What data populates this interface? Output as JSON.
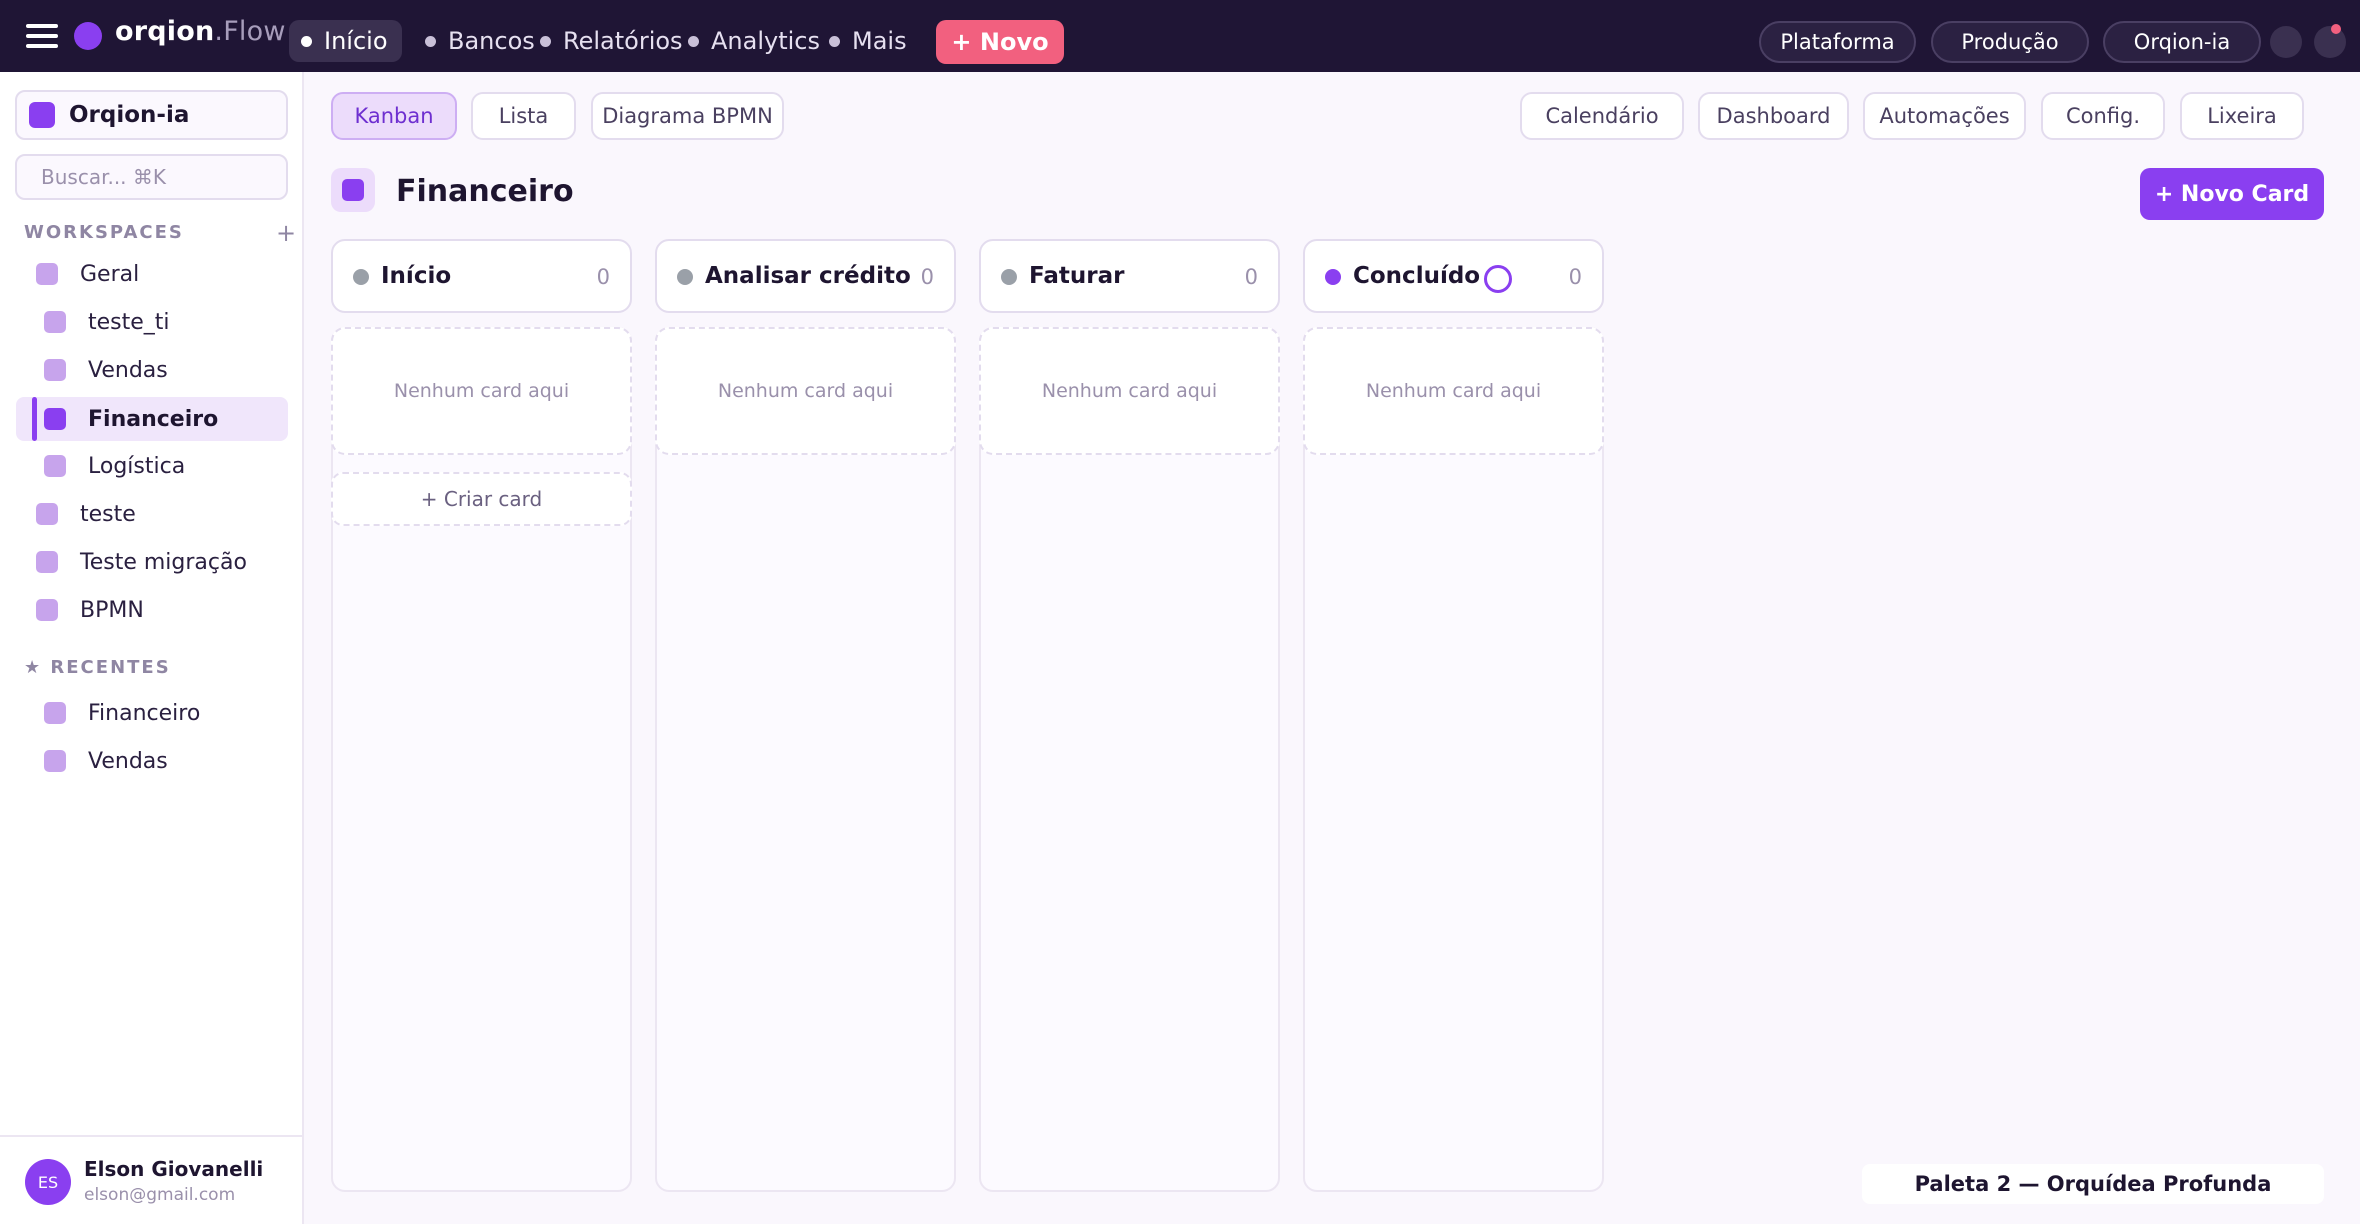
{
  "app": {
    "logo_main": "orqion",
    "logo_suffix": ".Flow",
    "nav": [
      {
        "label": "Início"
      },
      {
        "label": "Bancos"
      },
      {
        "label": "Relatórios"
      },
      {
        "label": "Analytics"
      },
      {
        "label": "Mais"
      }
    ],
    "new_label": "+ Novo",
    "pills": [
      "Plataforma",
      "Produção",
      "Orqion-ia"
    ]
  },
  "sidebar": {
    "workspace": "Orqion-ia",
    "search_placeholder": "Buscar... ⌘K",
    "workspaces_label": "WORKSPACES",
    "add_label": "+",
    "workspaces": [
      {
        "label": "Geral"
      },
      {
        "label": "teste_ti"
      },
      {
        "label": "Vendas"
      },
      {
        "label": "Financeiro"
      },
      {
        "label": "Logística"
      },
      {
        "label": "teste"
      },
      {
        "label": "Teste migração"
      },
      {
        "label": "BPMN"
      }
    ],
    "recent_label": "★ RECENTES",
    "recent": [
      {
        "label": "Financeiro"
      },
      {
        "label": "Vendas"
      }
    ],
    "user": {
      "initials": "ES",
      "name": "Elson Giovanelli",
      "email": "elson@gmail.com"
    }
  },
  "main": {
    "view_tabs": [
      "Kanban",
      "Lista",
      "Diagrama BPMN"
    ],
    "right_tabs": [
      "Calendário",
      "Dashboard",
      "Automações",
      "Config.",
      "Lixeira"
    ],
    "title": "Financeiro",
    "new_card_label": "+ Novo Card",
    "columns": [
      {
        "title": "Início",
        "count": "0",
        "empty": "Nenhum card aqui",
        "create": "+ Criar card"
      },
      {
        "title": "Analisar crédito",
        "count": "0",
        "empty": "Nenhum card aqui"
      },
      {
        "title": "Faturar",
        "count": "0",
        "empty": "Nenhum card aqui"
      },
      {
        "title": "Concluído",
        "count": "0",
        "empty": "Nenhum card aqui"
      }
    ],
    "palette_label": "Paleta 2 — Orquídea Profunda"
  },
  "colors": {
    "accent": "#8a3ff0",
    "topbar": "#1f1535",
    "new_button": "#f2607f"
  }
}
